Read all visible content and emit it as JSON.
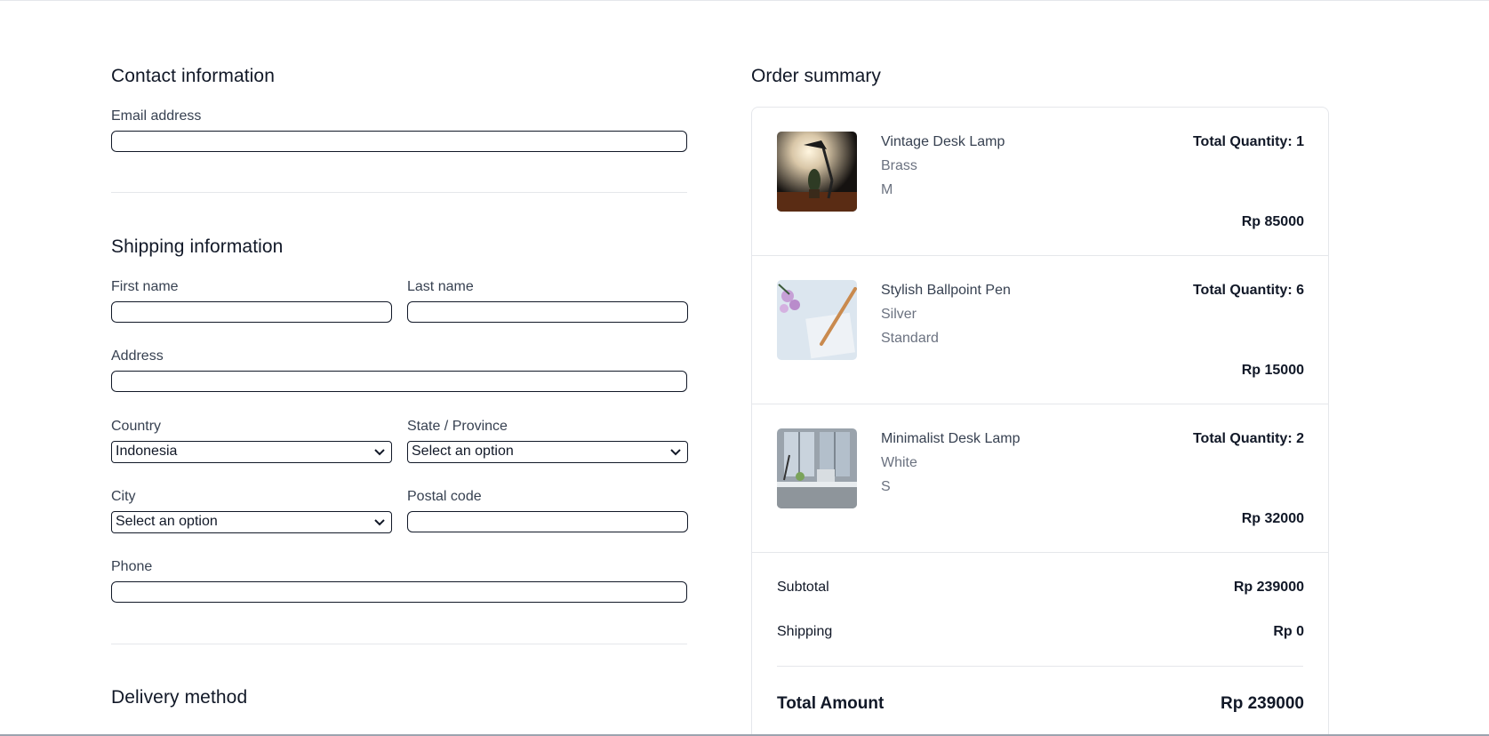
{
  "contact": {
    "title": "Contact information",
    "email_label": "Email address",
    "email_value": ""
  },
  "shipping": {
    "title": "Shipping information",
    "first_name_label": "First name",
    "last_name_label": "Last name",
    "address_label": "Address",
    "country_label": "Country",
    "country_value": "Indonesia",
    "state_label": "State / Province",
    "state_value": "Select an option",
    "city_label": "City",
    "city_value": "Select an option",
    "postal_label": "Postal code",
    "phone_label": "Phone"
  },
  "delivery": {
    "title": "Delivery method"
  },
  "summary": {
    "title": "Order summary",
    "items": [
      {
        "name": "Vintage Desk Lamp",
        "variant1": "Brass",
        "variant2": "M",
        "qty": "Total Quantity: 1",
        "price": "Rp 85000",
        "thumb_icon": "desk-lamp-photo"
      },
      {
        "name": "Stylish Ballpoint Pen",
        "variant1": "Silver",
        "variant2": "Standard",
        "qty": "Total Quantity: 6",
        "price": "Rp 15000",
        "thumb_icon": "ballpoint-pen-photo"
      },
      {
        "name": "Minimalist Desk Lamp",
        "variant1": "White",
        "variant2": "S",
        "qty": "Total Quantity: 2",
        "price": "Rp 32000",
        "thumb_icon": "desk-lamp-photo"
      }
    ],
    "subtotal_label": "Subtotal",
    "subtotal_value": "Rp 239000",
    "shipping_label": "Shipping",
    "shipping_value": "Rp 0",
    "total_label": "Total Amount",
    "total_value": "Rp 239000"
  }
}
